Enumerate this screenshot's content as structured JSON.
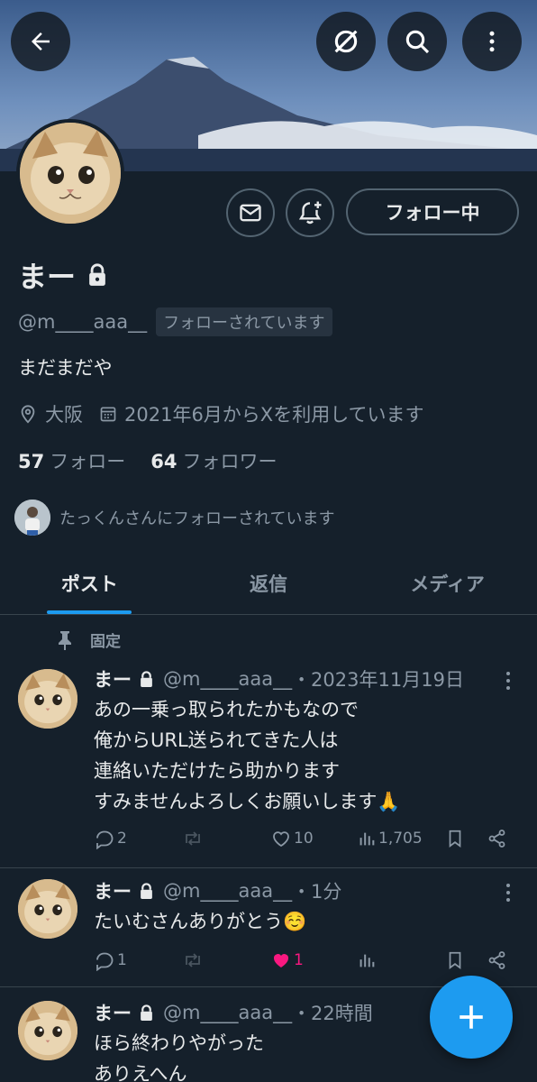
{
  "profile": {
    "name": "まー",
    "handle": "@m____aaa__",
    "follows_you": "フォローされています",
    "bio": "まだまだや",
    "location": "大阪",
    "joined": "2021年6月からXを利用しています",
    "following_count": "57",
    "following_label": "フォロー",
    "followers_count": "64",
    "followers_label": "フォロワー",
    "followed_by": "たっくんさんにフォローされています",
    "follow_button": "フォロー中"
  },
  "tabs": [
    {
      "label": "ポスト",
      "active": true
    },
    {
      "label": "返信",
      "active": false
    },
    {
      "label": "メディア",
      "active": false
    }
  ],
  "pinned_label": "固定",
  "posts": [
    {
      "name": "まー",
      "handle": "@m____aaa__",
      "time": "・2023年11月19日",
      "lines": [
        "あの一乗っ取られたかもなので",
        "俺からURL送られてきた人は",
        "連絡いただけたら助かります",
        "すみませんよろしくお願いします🙏"
      ],
      "replies": "2",
      "reposts": "",
      "likes": "10",
      "views": "1,705",
      "liked": false
    },
    {
      "name": "まー",
      "handle": "@m____aaa__",
      "time": "・1分",
      "lines": [
        "たいむさんありがとう☺️"
      ],
      "replies": "1",
      "reposts": "",
      "likes": "1",
      "views": "",
      "liked": true
    },
    {
      "name": "まー",
      "handle": "@m____aaa__",
      "time": "・22時間",
      "lines": [
        "ほら終わりやがった",
        "ありえへん"
      ]
    }
  ],
  "colors": {
    "background": "#15202b",
    "accent": "#1d9bf0",
    "like": "#f91880",
    "secondary_text": "#8b98a5"
  },
  "icons": [
    "back-arrow-icon",
    "grok-icon",
    "search-icon",
    "more-vertical-icon",
    "mail-icon",
    "bell-plus-icon",
    "lock-icon",
    "location-icon",
    "calendar-icon",
    "pin-icon",
    "reply-icon",
    "repost-icon",
    "heart-icon",
    "views-icon",
    "bookmark-icon",
    "share-icon",
    "plus-icon"
  ]
}
